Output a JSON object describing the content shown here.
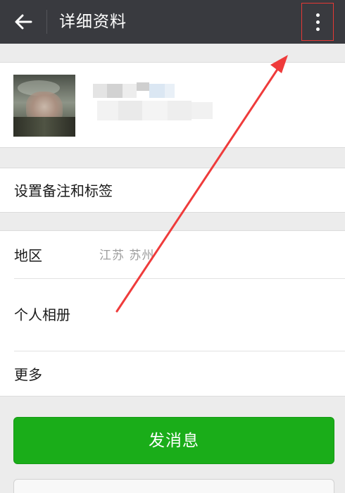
{
  "topbar": {
    "title": "详细资料",
    "back_icon": "arrow-left-icon",
    "more_icon": "more-vertical-icon",
    "background": "#393a3f",
    "highlight_color": "#e53935"
  },
  "profile": {
    "avatar_icon": "blurred-avatar-image",
    "name_obscured": true
  },
  "rows": {
    "remark_label": "设置备注和标签",
    "region_label": "地区",
    "region_value": "江苏  苏州",
    "album_label": "个人相册",
    "more_label": "更多"
  },
  "actions": {
    "send_label": "发消息",
    "send_color": "#1aad19"
  },
  "annotation": {
    "arrow_color": "#ef3b3b",
    "arrow_icon": "red-annotation-arrow"
  }
}
